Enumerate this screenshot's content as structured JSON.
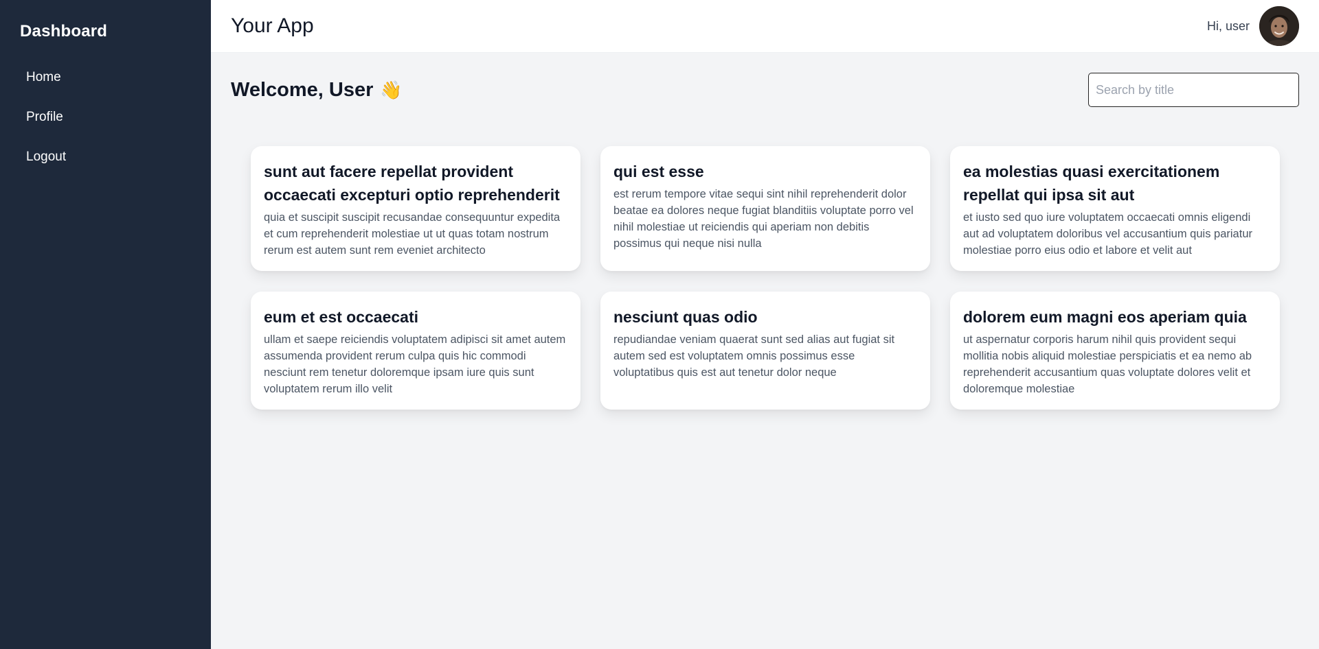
{
  "sidebar": {
    "title": "Dashboard",
    "items": [
      {
        "label": "Home"
      },
      {
        "label": "Profile"
      },
      {
        "label": "Logout"
      }
    ]
  },
  "header": {
    "title": "Your App",
    "greeting": "Hi, user",
    "avatar_icon": "user-avatar"
  },
  "main": {
    "welcome": "Welcome, User",
    "welcome_emoji": "👋",
    "search": {
      "placeholder": "Search by title",
      "value": ""
    },
    "posts": [
      {
        "title": "sunt aut facere repellat provident occaecati excepturi optio reprehenderit",
        "body": "quia et suscipit suscipit recusandae consequuntur expedita et cum reprehenderit molestiae ut ut quas totam nostrum rerum est autem sunt rem eveniet architecto"
      },
      {
        "title": "qui est esse",
        "body": "est rerum tempore vitae sequi sint nihil reprehenderit dolor beatae ea dolores neque fugiat blanditiis voluptate porro vel nihil molestiae ut reiciendis qui aperiam non debitis possimus qui neque nisi nulla"
      },
      {
        "title": "ea molestias quasi exercitationem repellat qui ipsa sit aut",
        "body": "et iusto sed quo iure voluptatem occaecati omnis eligendi aut ad voluptatem doloribus vel accusantium quis pariatur molestiae porro eius odio et labore et velit aut"
      },
      {
        "title": "eum et est occaecati",
        "body": "ullam et saepe reiciendis voluptatem adipisci sit amet autem assumenda provident rerum culpa quis hic commodi nesciunt rem tenetur doloremque ipsam iure quis sunt voluptatem rerum illo velit"
      },
      {
        "title": "nesciunt quas odio",
        "body": "repudiandae veniam quaerat sunt sed alias aut fugiat sit autem sed est voluptatem omnis possimus esse voluptatibus quis est aut tenetur dolor neque"
      },
      {
        "title": "dolorem eum magni eos aperiam quia",
        "body": "ut aspernatur corporis harum nihil quis provident sequi mollitia nobis aliquid molestiae perspiciatis et ea nemo ab reprehenderit accusantium quas voluptate dolores velit et doloremque molestiae"
      }
    ]
  },
  "colors": {
    "sidebar_bg": "#1e293b",
    "page_bg": "#f3f4f6",
    "card_bg": "#ffffff"
  }
}
